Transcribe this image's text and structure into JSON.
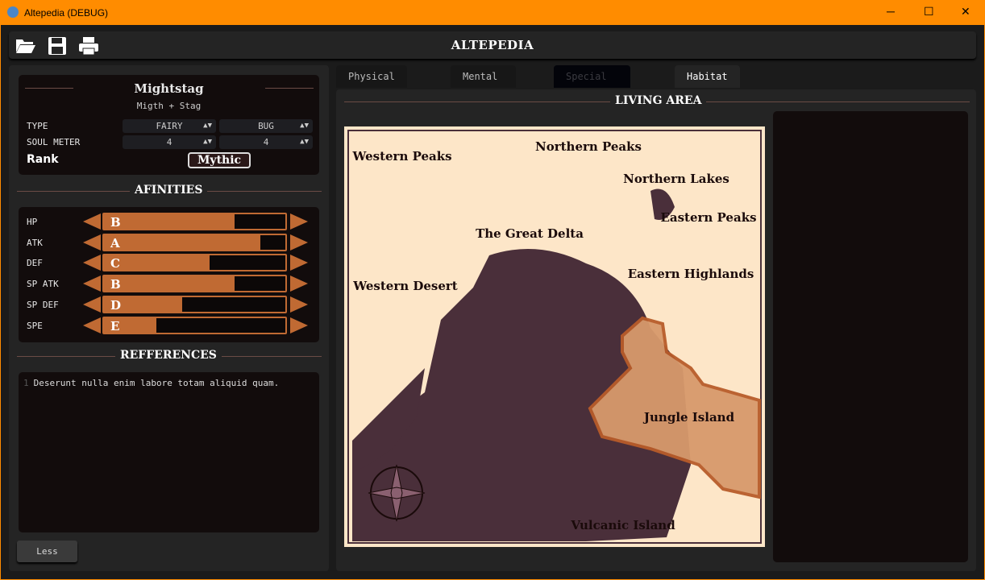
{
  "window": {
    "title": "Altepedia (DEBUG)",
    "minimize": "─",
    "maximize": "☐",
    "close": "✕"
  },
  "toolbar": {
    "title": "ALTEPEDIA",
    "icons": [
      "folder-open-icon",
      "save-icon",
      "print-icon"
    ]
  },
  "creature": {
    "name": "Mightstag",
    "subtitle": "Migth + Stag",
    "type_label": "TYPE",
    "type1": "FAIRY",
    "type2": "BUG",
    "soul_label": "SOUL METER",
    "soul1": "4",
    "soul2": "4",
    "rank_label": "Rank",
    "rank": "Mythic"
  },
  "afinities": {
    "title": "AFINITIES",
    "rows": [
      {
        "stat": "HP",
        "grade": "B",
        "level": 0.72
      },
      {
        "stat": "ATK",
        "grade": "A",
        "level": 0.86
      },
      {
        "stat": "DEF",
        "grade": "C",
        "level": 0.58
      },
      {
        "stat": "SP ATK",
        "grade": "B",
        "level": 0.72
      },
      {
        "stat": "SP DEF",
        "grade": "D",
        "level": 0.43
      },
      {
        "stat": "SPE",
        "grade": "E",
        "level": 0.29
      }
    ]
  },
  "references": {
    "title": "REFFERENCES",
    "line_number": "1",
    "text": "Deserunt nulla enim labore totam aliquid quam."
  },
  "less_button": "Less",
  "tabs": [
    {
      "label": "Physical Profile"
    },
    {
      "label": "Mental Profile"
    },
    {
      "label": "Special Abilities"
    },
    {
      "label": "Habitat"
    }
  ],
  "habitat": {
    "title": "LIVING AREA",
    "selected_region": "Jungle Island",
    "regions": [
      "Western Peaks",
      "Northern Peaks",
      "Northern Lakes",
      "Eastern Peaks",
      "The Great Delta",
      "Western Desert",
      "Eastern Highlands",
      "Jungle Island",
      "Vulcanic Island"
    ]
  },
  "colors": {
    "accent": "#c06a33",
    "titlebar": "#ff8c00",
    "sea": "#4a2f3a",
    "land": "#fde6c8"
  }
}
